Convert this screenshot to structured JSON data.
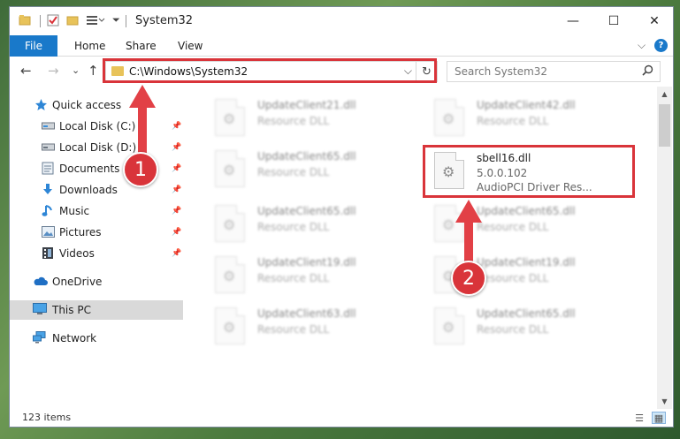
{
  "window": {
    "title": "System32",
    "controls": {
      "minimize": "—",
      "maximize": "☐",
      "close": "✕"
    }
  },
  "ribbon": {
    "tabs": [
      "File",
      "Home",
      "Share",
      "View"
    ],
    "expand_glyph": "⌵",
    "help_glyph": "?"
  },
  "address": {
    "path": "C:\\Windows\\System32",
    "dropdown_glyph": "⌵",
    "refresh_glyph": "↻"
  },
  "search": {
    "placeholder": "Search System32",
    "icon": "search-icon"
  },
  "nav": {
    "back": "←",
    "forward": "→",
    "recent": "⌄",
    "up": "↑"
  },
  "sidebar": {
    "items": [
      {
        "label": "Quick access",
        "icon": "star-icon",
        "pinned": false
      },
      {
        "label": "Local Disk (C:)",
        "icon": "drive-icon",
        "pinned": true
      },
      {
        "label": "Local Disk (D:)",
        "icon": "drive-icon",
        "pinned": true
      },
      {
        "label": "Documents",
        "icon": "documents-icon",
        "pinned": true
      },
      {
        "label": "Downloads",
        "icon": "downloads-icon",
        "pinned": true
      },
      {
        "label": "Music",
        "icon": "music-icon",
        "pinned": true
      },
      {
        "label": "Pictures",
        "icon": "pictures-icon",
        "pinned": true
      },
      {
        "label": "Videos",
        "icon": "videos-icon",
        "pinned": true
      },
      {
        "label": "OneDrive",
        "icon": "cloud-icon",
        "pinned": false
      },
      {
        "label": "This PC",
        "icon": "computer-icon",
        "pinned": false,
        "selected": true
      },
      {
        "label": "Network",
        "icon": "network-icon",
        "pinned": false
      }
    ]
  },
  "files": [
    {
      "name": "UpdateClient21.dll",
      "type": "Resource DLL",
      "blurred": true
    },
    {
      "name": "UpdateClient42.dll",
      "type": "Resource DLL",
      "blurred": true
    },
    {
      "name": "UpdateClient65.dll",
      "type": "Resource DLL",
      "blurred": true
    },
    {
      "name": "sbell16.dll",
      "version": "5.0.0.102",
      "type": "AudioPCI Driver Res...",
      "blurred": false
    },
    {
      "name": "UpdateClient65.dll",
      "type": "Resource DLL",
      "blurred": true
    },
    {
      "name": "UpdateClient65.dll",
      "type": "Resource DLL",
      "blurred": true
    },
    {
      "name": "UpdateClient19.dll",
      "type": "Resource DLL",
      "blurred": true
    },
    {
      "name": "UpdateClient19.dll",
      "type": "Resource DLL",
      "blurred": true
    },
    {
      "name": "UpdateClient63.dll",
      "type": "Resource DLL",
      "blurred": true
    },
    {
      "name": "UpdateClient65.dll",
      "type": "Resource DLL",
      "blurred": true
    }
  ],
  "status": {
    "item_count": "123 items"
  },
  "annotations": {
    "step1": "1",
    "step2": "2",
    "color": "#d9343a"
  }
}
